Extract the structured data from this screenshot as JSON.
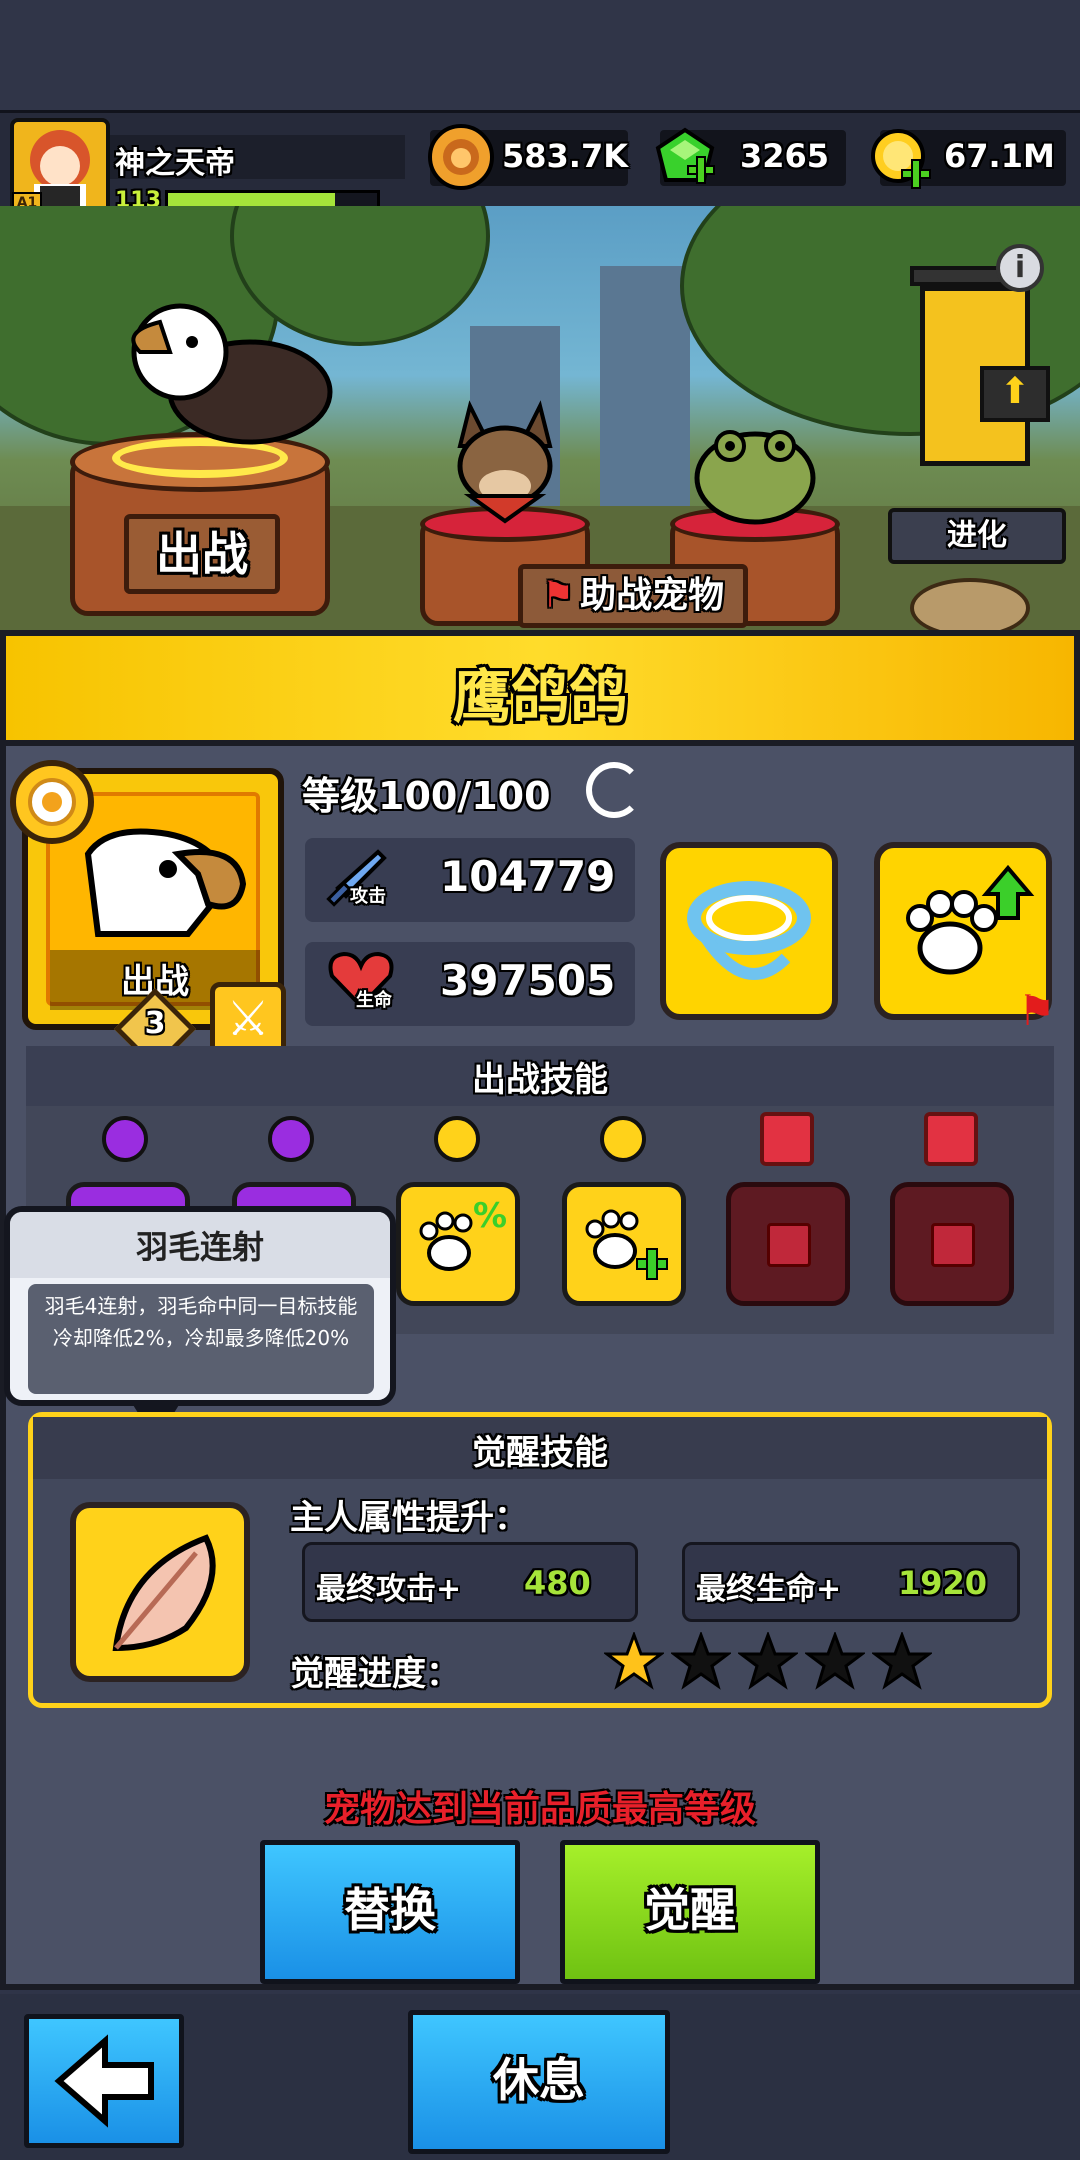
{
  "player": {
    "name": "神之天帝",
    "level": "113",
    "rank_badge": "A1",
    "xp_fraction": 0.8
  },
  "currencies": [
    {
      "icon": "lion-coin-icon",
      "value": "583.7K"
    },
    {
      "icon": "green-gem-icon",
      "value": "3265"
    },
    {
      "icon": "gold-coin-icon",
      "value": "67.1M"
    }
  ],
  "scene": {
    "deploy_label": "出战",
    "assist_label": "助战宠物",
    "evolve_label": "进化",
    "info_icon": "info-icon"
  },
  "pet": {
    "name": "鹰鸽鸽",
    "level": "等级100/100",
    "portrait_label": "出战",
    "star_badge": "3",
    "attack_label": "攻击",
    "attack": "104779",
    "hp_label": "生命",
    "hp": "397505"
  },
  "battle_skills": {
    "title": "出战技能"
  },
  "tooltip": {
    "title": "羽毛连射",
    "body": "羽毛4连射，羽毛命中同一目标技能冷却降低2%，冷却最多降低20%"
  },
  "awaken": {
    "title": "觉醒技能",
    "attr_title": "主人属性提升：",
    "atk_label": "最终攻击+",
    "atk_value": "480",
    "hp_label": "最终生命+",
    "hp_value": "1920",
    "progress_label": "觉醒进度：",
    "progress_stars": 1,
    "total_stars": 5
  },
  "notice": "宠物达到当前品质最高等级",
  "buttons": {
    "replace": "替换",
    "awaken": "觉醒",
    "rest": "休息"
  },
  "colors": {
    "accent_yellow": "#ffd21a",
    "notice_red": "#e8202a",
    "attr_green": "#a6e43a",
    "btn_blue": "#1ea8f0",
    "btn_green": "#8bd819"
  }
}
